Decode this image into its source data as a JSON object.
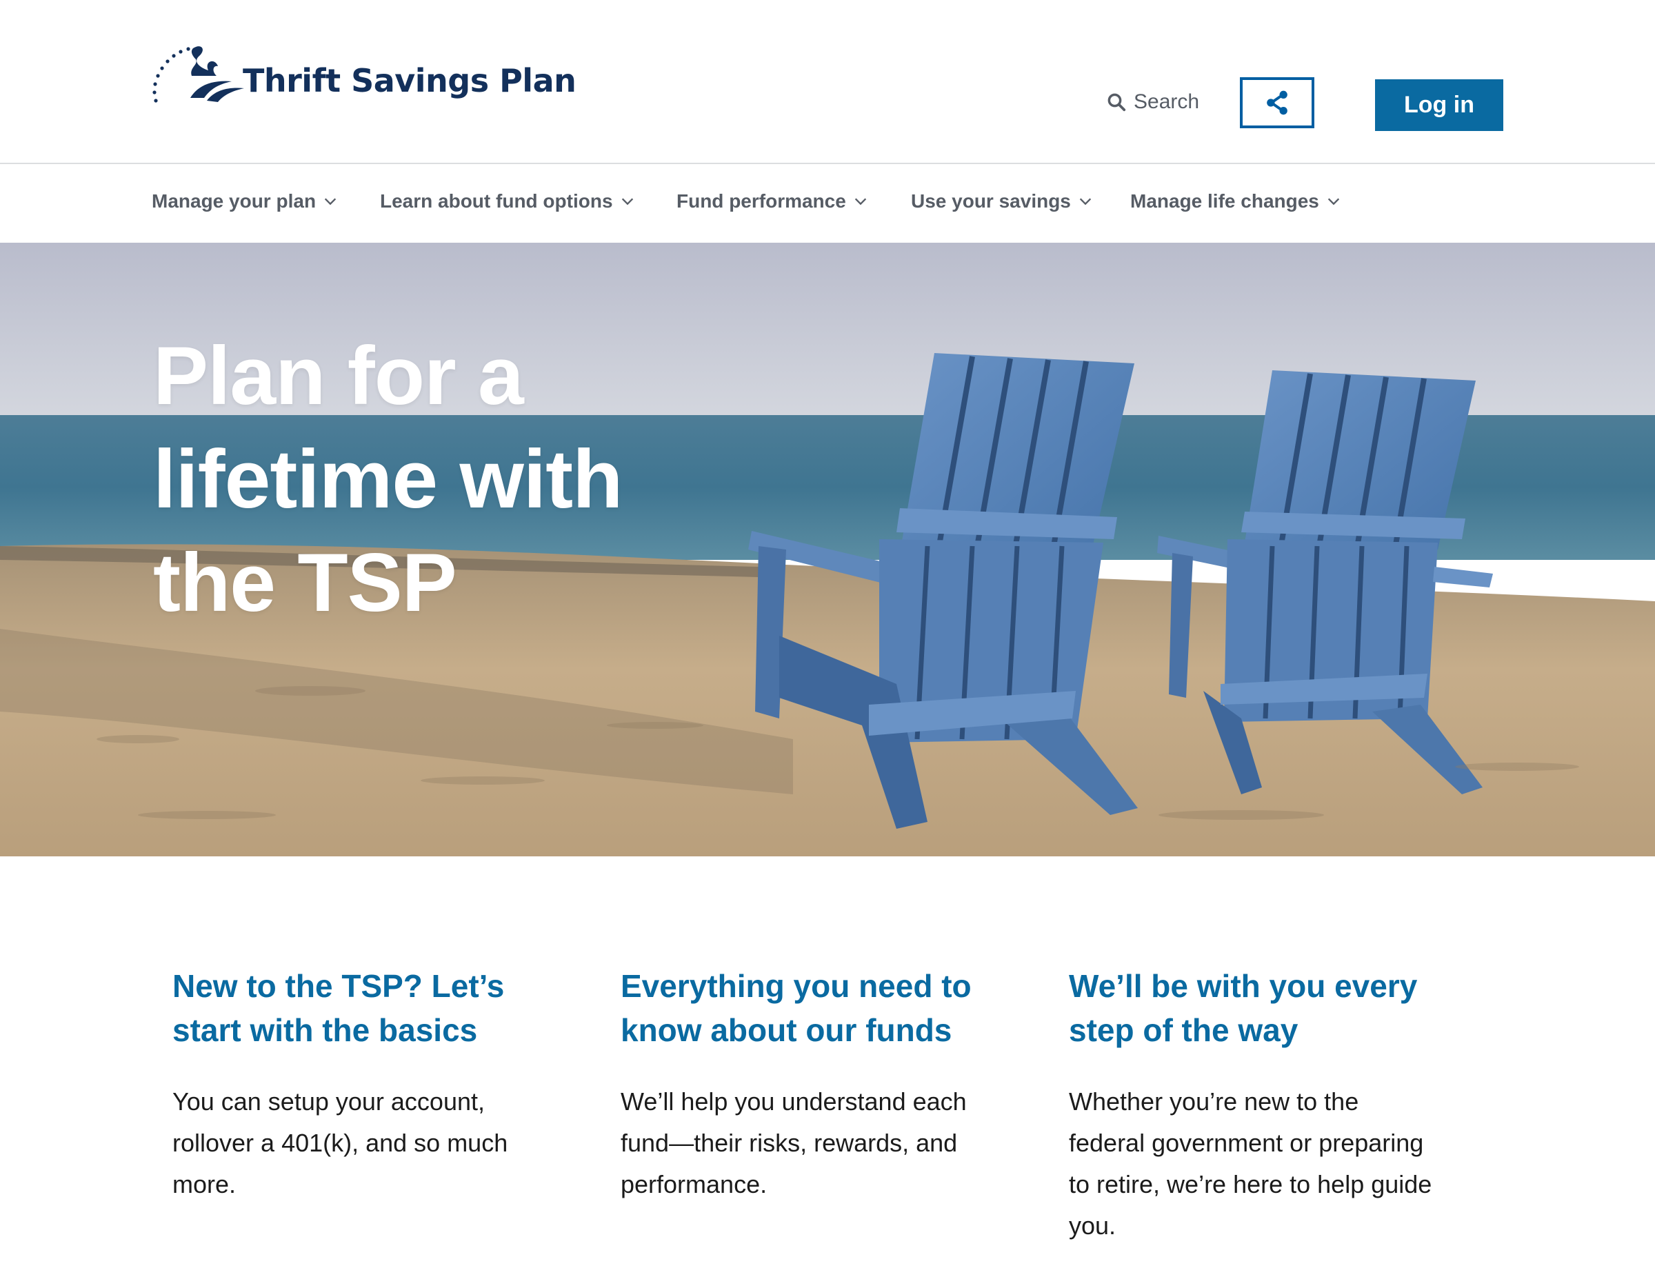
{
  "header": {
    "logo_text": "Thrift Savings Plan",
    "search_label": "Search",
    "share_icon": "share-icon",
    "login_label": "Log in"
  },
  "nav": {
    "items": [
      {
        "label": "Manage your plan"
      },
      {
        "label": "Learn about fund options"
      },
      {
        "label": "Fund performance"
      },
      {
        "label": "Use your savings"
      },
      {
        "label": "Manage life changes"
      }
    ]
  },
  "hero": {
    "title": "Plan for a lifetime with the TSP"
  },
  "features": [
    {
      "title": "New to the TSP? Let’s start with the basics",
      "body": "You can setup your account, rollover a 401(k), and so much more."
    },
    {
      "title": "Everything you need to know about our funds",
      "body": "We’ll help you understand each fund—their risks, rewards, and performance."
    },
    {
      "title": "We’ll be with you every step of the way",
      "body": "Whether you’re new to the federal government or preparing to retire, we’re here to help guide you."
    }
  ],
  "colors": {
    "brand_navy": "#13305b",
    "primary_blue": "#0a6aa1",
    "nav_gray": "#565c65"
  }
}
